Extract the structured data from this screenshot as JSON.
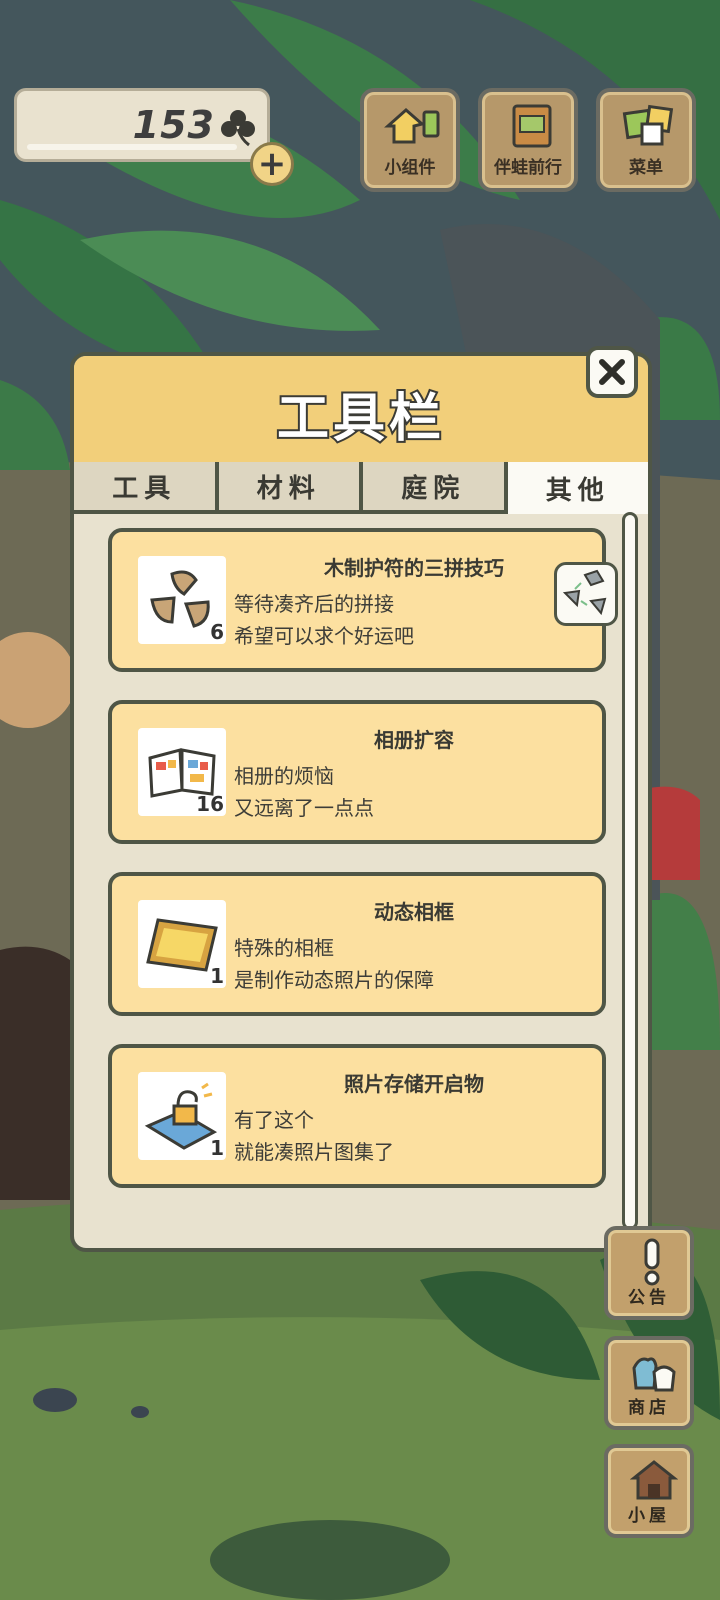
{
  "currency": {
    "amount": "153",
    "icon": "clover-icon",
    "add_icon": "plus-icon"
  },
  "top_buttons": [
    {
      "label": "小组件",
      "icon": "widget-icon"
    },
    {
      "label": "伴蛙前行",
      "icon": "frog-travel-icon"
    },
    {
      "label": "菜单",
      "icon": "menu-icon"
    }
  ],
  "panel": {
    "title": "工具栏",
    "close_icon": "close-icon",
    "tabs": [
      {
        "label": "工具",
        "active": false
      },
      {
        "label": "材料",
        "active": false
      },
      {
        "label": "庭院",
        "active": false
      },
      {
        "label": "其他",
        "active": true
      }
    ],
    "items": [
      {
        "title": "木制护符的三拼技巧",
        "count": "6",
        "desc1": "等待凑齐后的拼接",
        "desc2": "希望可以求个好运吧",
        "icon": "wooden-charm-pieces-icon"
      },
      {
        "title": "相册扩容",
        "count": "16",
        "desc1": "相册的烦恼",
        "desc2": "又远离了一点点",
        "icon": "album-icon"
      },
      {
        "title": "动态相框",
        "count": "1",
        "desc1": "特殊的相框",
        "desc2": "是制作动态照片的保障",
        "icon": "photo-frame-icon"
      },
      {
        "title": "照片存储开启物",
        "count": "1",
        "desc1": "有了这个",
        "desc2": "就能凑照片图集了",
        "icon": "unlock-icon"
      }
    ],
    "side_chip_icon": "stone-pieces-icon"
  },
  "side_buttons": [
    {
      "label": "公告",
      "icon": "exclamation-icon"
    },
    {
      "label": "商店",
      "icon": "shop-bags-icon"
    },
    {
      "label": "小屋",
      "icon": "house-icon"
    }
  ]
}
